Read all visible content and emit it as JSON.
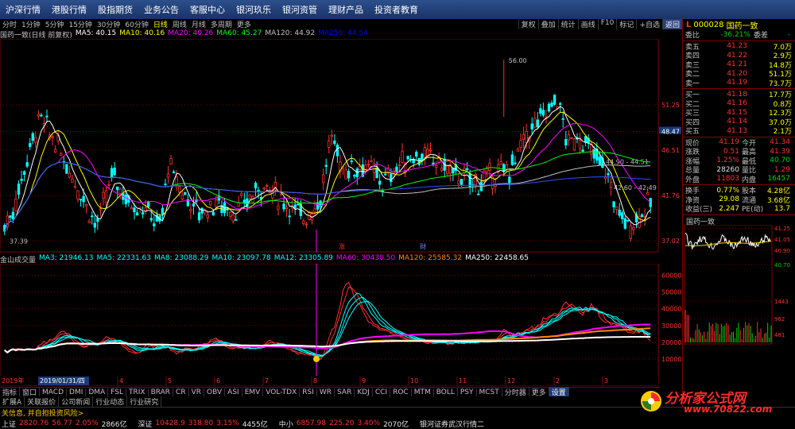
{
  "top_menu": [
    "沪深行情",
    "港股行情",
    "股指期货",
    "业务公告",
    "客服中心",
    "银河玖乐",
    "银河资管",
    "理财产品",
    "投资者教育"
  ],
  "period_bar": {
    "items": [
      "分时",
      "1分钟",
      "5分钟",
      "15分钟",
      "30分钟",
      "60分钟",
      "日线",
      "周线",
      "月线",
      "多周期",
      "更多"
    ],
    "active": "日线",
    "right_tools": [
      "复权",
      "叠加",
      "统计",
      "画线",
      "F10",
      "标记",
      "+自选",
      "返回"
    ]
  },
  "main_legend": {
    "title": "国药一致(日线 前复权)",
    "items": [
      {
        "label": "MA5: 40.15",
        "color": "#ffffff"
      },
      {
        "label": "MA10: 40.16",
        "color": "#ffff00"
      },
      {
        "label": "MA20: 40.26",
        "color": "#ff00ff"
      },
      {
        "label": "MA60: 45.27",
        "color": "#00ff00"
      },
      {
        "label": "MA120: 44.92",
        "color": "#c0c0c0"
      },
      {
        "label": "MA250: 44.54",
        "color": "#0000ff"
      }
    ]
  },
  "main_axis": [
    "51.25",
    "48.47",
    "46.51",
    "41.76",
    "37.02"
  ],
  "main_annotations": {
    "high": "56.00",
    "low": "37.39",
    "mid1": "44.90 - 44.51",
    "mid2": "42.60 - 42.49"
  },
  "event_marks": [
    "涨",
    "财"
  ],
  "vol_legend": {
    "title": "金山成交量",
    "items": [
      {
        "label": "MA3: 21946.13",
        "color": "#00ffff"
      },
      {
        "label": "MA5: 22331.63",
        "color": "#00ffff"
      },
      {
        "label": "MA8: 23088.29",
        "color": "#00ffff"
      },
      {
        "label": "MA10: 23097.78",
        "color": "#00ffff"
      },
      {
        "label": "MA12: 23305.89",
        "color": "#00ffff"
      },
      {
        "label": "MA60: 30430.50",
        "color": "#ff00ff"
      },
      {
        "label": "MA120: 25585.32",
        "color": "#ff8800"
      },
      {
        "label": "MA250: 22458.65",
        "color": "#ffffff"
      }
    ]
  },
  "vol_axis": [
    "60000",
    "50000",
    "40000",
    "30000",
    "20000",
    "10000"
  ],
  "date_axis": {
    "year_start": "2019年",
    "cursor_date": "2019/01/31/四",
    "months": [
      "4",
      "5",
      "6",
      "7",
      "8",
      "9",
      "10",
      "11",
      "12",
      "2",
      "3"
    ]
  },
  "bottom_tabs": [
    "指标",
    "窗口",
    "MACD",
    "DMI",
    "DMA",
    "FSL",
    "TRIX",
    "BRAR",
    "CR",
    "VR",
    "OBV",
    "ASI",
    "EMV",
    "VOL-TDX",
    "RSI",
    "WR",
    "SAR",
    "KDJ",
    "CCI",
    "ROC",
    "MTM",
    "BOLL",
    "PSY",
    "MCST",
    "分时器",
    "更多",
    "设置"
  ],
  "bottom_tabs2": [
    "扩展A",
    "关联报价",
    "公司新闻",
    "行业动态",
    "行业研究"
  ],
  "status": "关信息, 并自担投资风险>",
  "index_bar": [
    {
      "name": "上证",
      "price": "2820.76",
      "change": "56.77",
      "pct": "2.05%",
      "amount": "2866亿",
      "dir": "up"
    },
    {
      "name": "深证",
      "price": "10428.9",
      "change": "318.80",
      "pct": "3.15%",
      "amount": "4455亿",
      "dir": "up"
    },
    {
      "name": "中小",
      "price": "6857.98",
      "change": "225.20",
      "pct": "3.40%",
      "amount": "2070亿",
      "dir": "up"
    }
  ],
  "broker": "银河证券武汉行情二",
  "right_panel": {
    "code": "000028",
    "name": "国药一致",
    "weibi_label": "委比",
    "weibi": "-36.21%",
    "weicha_label": "委差",
    "weicha": "-",
    "asks": [
      {
        "label": "卖五",
        "price": "41.23",
        "vol": "7.0万"
      },
      {
        "label": "卖四",
        "price": "41.22",
        "vol": "2.9万"
      },
      {
        "label": "卖三",
        "price": "41.21",
        "vol": "14.8万"
      },
      {
        "label": "卖二",
        "price": "41.20",
        "vol": "51.1万"
      },
      {
        "label": "卖一",
        "price": "41.19",
        "vol": "73.7万"
      }
    ],
    "bids": [
      {
        "label": "买一",
        "price": "41.18",
        "vol": "17.7万"
      },
      {
        "label": "买二",
        "price": "41.16",
        "vol": "0.8万"
      },
      {
        "label": "买三",
        "price": "41.15",
        "vol": "12.3万"
      },
      {
        "label": "买四",
        "price": "41.14",
        "vol": "37.0万"
      },
      {
        "label": "买五",
        "price": "41.13",
        "vol": "2.1万"
      }
    ],
    "stats": [
      {
        "l1": "现价",
        "v1": "41.19",
        "c1": "up",
        "l2": "今开",
        "v2": "41.34",
        "c2": "up"
      },
      {
        "l1": "涨跌",
        "v1": "0.51",
        "c1": "up",
        "l2": "最高",
        "v2": "41.39",
        "c2": "up"
      },
      {
        "l1": "涨幅",
        "v1": "1.25%",
        "c1": "up",
        "l2": "最低",
        "v2": "40.70",
        "c2": "dn"
      },
      {
        "l1": "总量",
        "v1": "28260",
        "c1": "wh",
        "l2": "量比",
        "v2": "1.29",
        "c2": "up"
      },
      {
        "l1": "外盘",
        "v1": "11803",
        "c1": "up",
        "l2": "内盘",
        "v2": "16457",
        "c2": "dn"
      }
    ],
    "stats2": [
      {
        "l1": "换手",
        "v1": "0.77%",
        "l2": "股本",
        "v2": "4.28亿"
      },
      {
        "l1": "净资",
        "v1": "29.08",
        "l2": "流通",
        "v2": "3.68亿"
      },
      {
        "l1": "收益(三)",
        "v1": "2.247",
        "l2": "PE(动)",
        "v2": "13.7"
      }
    ],
    "mini_title": "国药一致",
    "mini_axis": [
      "41.25",
      "41.05",
      "40.90",
      "40.70",
      "1443",
      "962",
      "481"
    ]
  },
  "watermark": {
    "line1": "分析家公式网",
    "line2": "www.70822.com"
  }
}
